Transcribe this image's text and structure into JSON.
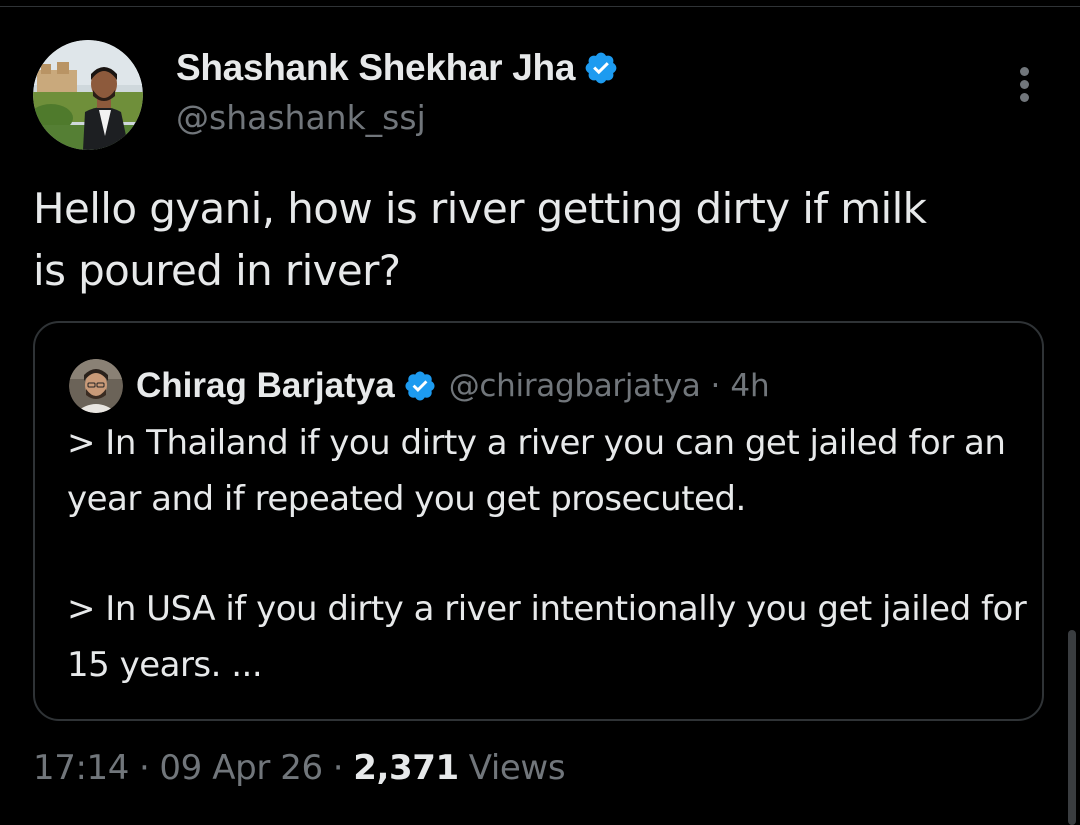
{
  "tweet": {
    "author": {
      "display_name": "Shashank Shekhar Jha",
      "handle": "@shashank_ssj",
      "verified": true,
      "avatar_icon": "profile-photo"
    },
    "text": "Hello gyani, how is river getting dirty if milk\nis poured in river?",
    "quoted_tweet": {
      "author": {
        "display_name": "Chirag Barjatya",
        "handle": "@chiragbarjatya",
        "verified": true,
        "avatar_icon": "profile-photo"
      },
      "separator": "·",
      "time_ago": "4h",
      "paragraphs": [
        "> In Thailand if you dirty a river you can get jailed for an year and if repeated you get prosecuted.",
        "> In USA if you dirty a river intentionally you get jailed for 15 years. ..."
      ]
    },
    "meta": {
      "time": "17:14",
      "date": "09 Apr 26",
      "separator": "·",
      "views_count": "2,371",
      "views_label": "Views"
    },
    "more_icon": "more-vertical-icon"
  },
  "colors": {
    "background": "#000000",
    "primary_text": "#e7e9ea",
    "secondary_text": "#71767b",
    "border": "#2f3336",
    "verified_blue": "#1d9bf0"
  }
}
